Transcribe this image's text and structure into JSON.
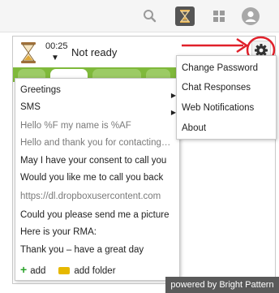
{
  "header": {
    "icons": [
      "search-icon",
      "hourglass-icon",
      "grid-icon",
      "avatar-icon"
    ]
  },
  "agent": {
    "timer": "00:25",
    "state": "Not ready",
    "state_caret": "▼"
  },
  "responses_menu": {
    "items": [
      {
        "label": "Greetings",
        "submenu": true
      },
      {
        "label": "SMS",
        "submenu": true
      },
      {
        "label": "Hello %F my name is %AF",
        "muted": true
      },
      {
        "label": "Hello and thank you for contacting us",
        "muted": true
      },
      {
        "label": "May I have your consent to call you"
      },
      {
        "label": "Would you like me to call you back"
      },
      {
        "label": "https://dl.dropboxusercontent.com",
        "muted": true
      },
      {
        "label": "Could you please send me a picture"
      },
      {
        "label": "Here is your RMA:"
      },
      {
        "label": "Thank you – have a great day"
      }
    ],
    "add_label": "add",
    "add_folder_label": "add folder"
  },
  "settings_menu": {
    "items": [
      "Change Password",
      "Chat Responses",
      "Web Notifications",
      "About"
    ]
  },
  "colors": {
    "tab_bar_green": "#7fb93b",
    "annotation_red": "#e0202a",
    "accent_dark": "#555555"
  },
  "watermark": "powered by Bright Pattern"
}
